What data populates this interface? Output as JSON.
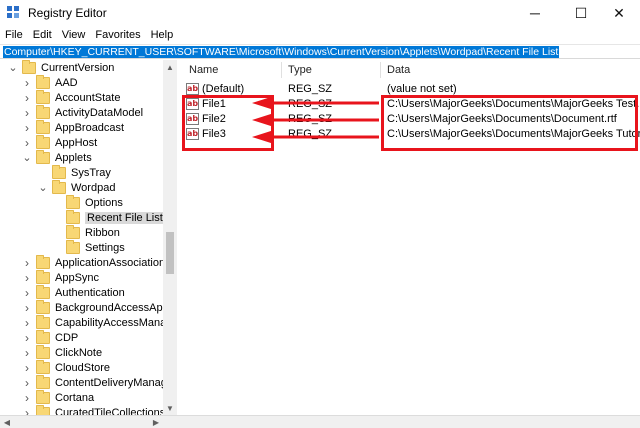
{
  "window": {
    "title": "Registry Editor",
    "app_icon": "registry-icon",
    "controls": {
      "minimize": "─",
      "maximize": "☐",
      "close": "✕"
    }
  },
  "menubar": {
    "items": [
      "File",
      "Edit",
      "View",
      "Favorites",
      "Help"
    ]
  },
  "address": {
    "path": "Computer\\HKEY_CURRENT_USER\\SOFTWARE\\Microsoft\\Windows\\CurrentVersion\\Applets\\Wordpad\\Recent File List"
  },
  "tree": {
    "items": [
      {
        "label": "CurrentVersion",
        "expanded": true
      },
      {
        "label": "AAD",
        "expanded": false
      },
      {
        "label": "AccountState",
        "expanded": false
      },
      {
        "label": "ActivityDataModel",
        "expanded": false
      },
      {
        "label": "AppBroadcast",
        "expanded": false
      },
      {
        "label": "AppHost",
        "expanded": false
      },
      {
        "label": "Applets",
        "expanded": true
      },
      {
        "label": "SysTray",
        "expanded": false
      },
      {
        "label": "Wordpad",
        "expanded": true
      },
      {
        "label": "Options",
        "expanded": false
      },
      {
        "label": "Recent File List",
        "expanded": false,
        "selected": true
      },
      {
        "label": "Ribbon",
        "expanded": false
      },
      {
        "label": "Settings",
        "expanded": false
      },
      {
        "label": "ApplicationAssociationTo",
        "expanded": false
      },
      {
        "label": "AppSync",
        "expanded": false
      },
      {
        "label": "Authentication",
        "expanded": false
      },
      {
        "label": "BackgroundAccessApplic",
        "expanded": false
      },
      {
        "label": "CapabilityAccessManage",
        "expanded": false
      },
      {
        "label": "CDP",
        "expanded": false
      },
      {
        "label": "ClickNote",
        "expanded": false
      },
      {
        "label": "CloudStore",
        "expanded": false
      },
      {
        "label": "ContentDeliveryManager",
        "expanded": false
      },
      {
        "label": "Cortana",
        "expanded": false
      },
      {
        "label": "CuratedTileCollections",
        "expanded": false
      }
    ]
  },
  "list": {
    "columns": [
      "Name",
      "Type",
      "Data"
    ],
    "rows": [
      {
        "name": "(Default)",
        "type": "REG_SZ",
        "data": "(value not set)"
      },
      {
        "name": "File1",
        "type": "REG_SZ",
        "data": "C:\\Users\\MajorGeeks\\Documents\\MajorGeeks Test.rtf"
      },
      {
        "name": "File2",
        "type": "REG_SZ",
        "data": "C:\\Users\\MajorGeeks\\Documents\\Document.rtf"
      },
      {
        "name": "File3",
        "type": "REG_SZ",
        "data": "C:\\Users\\MajorGeeks\\Documents\\MajorGeeks Tutorial.rtf"
      }
    ],
    "value_icon_text": "ab"
  },
  "annotation": {
    "color": "#e8141c"
  },
  "colors": {
    "address_highlight": "#0078d7",
    "folder": "#f8d775",
    "selection": "#d9d9d9"
  }
}
